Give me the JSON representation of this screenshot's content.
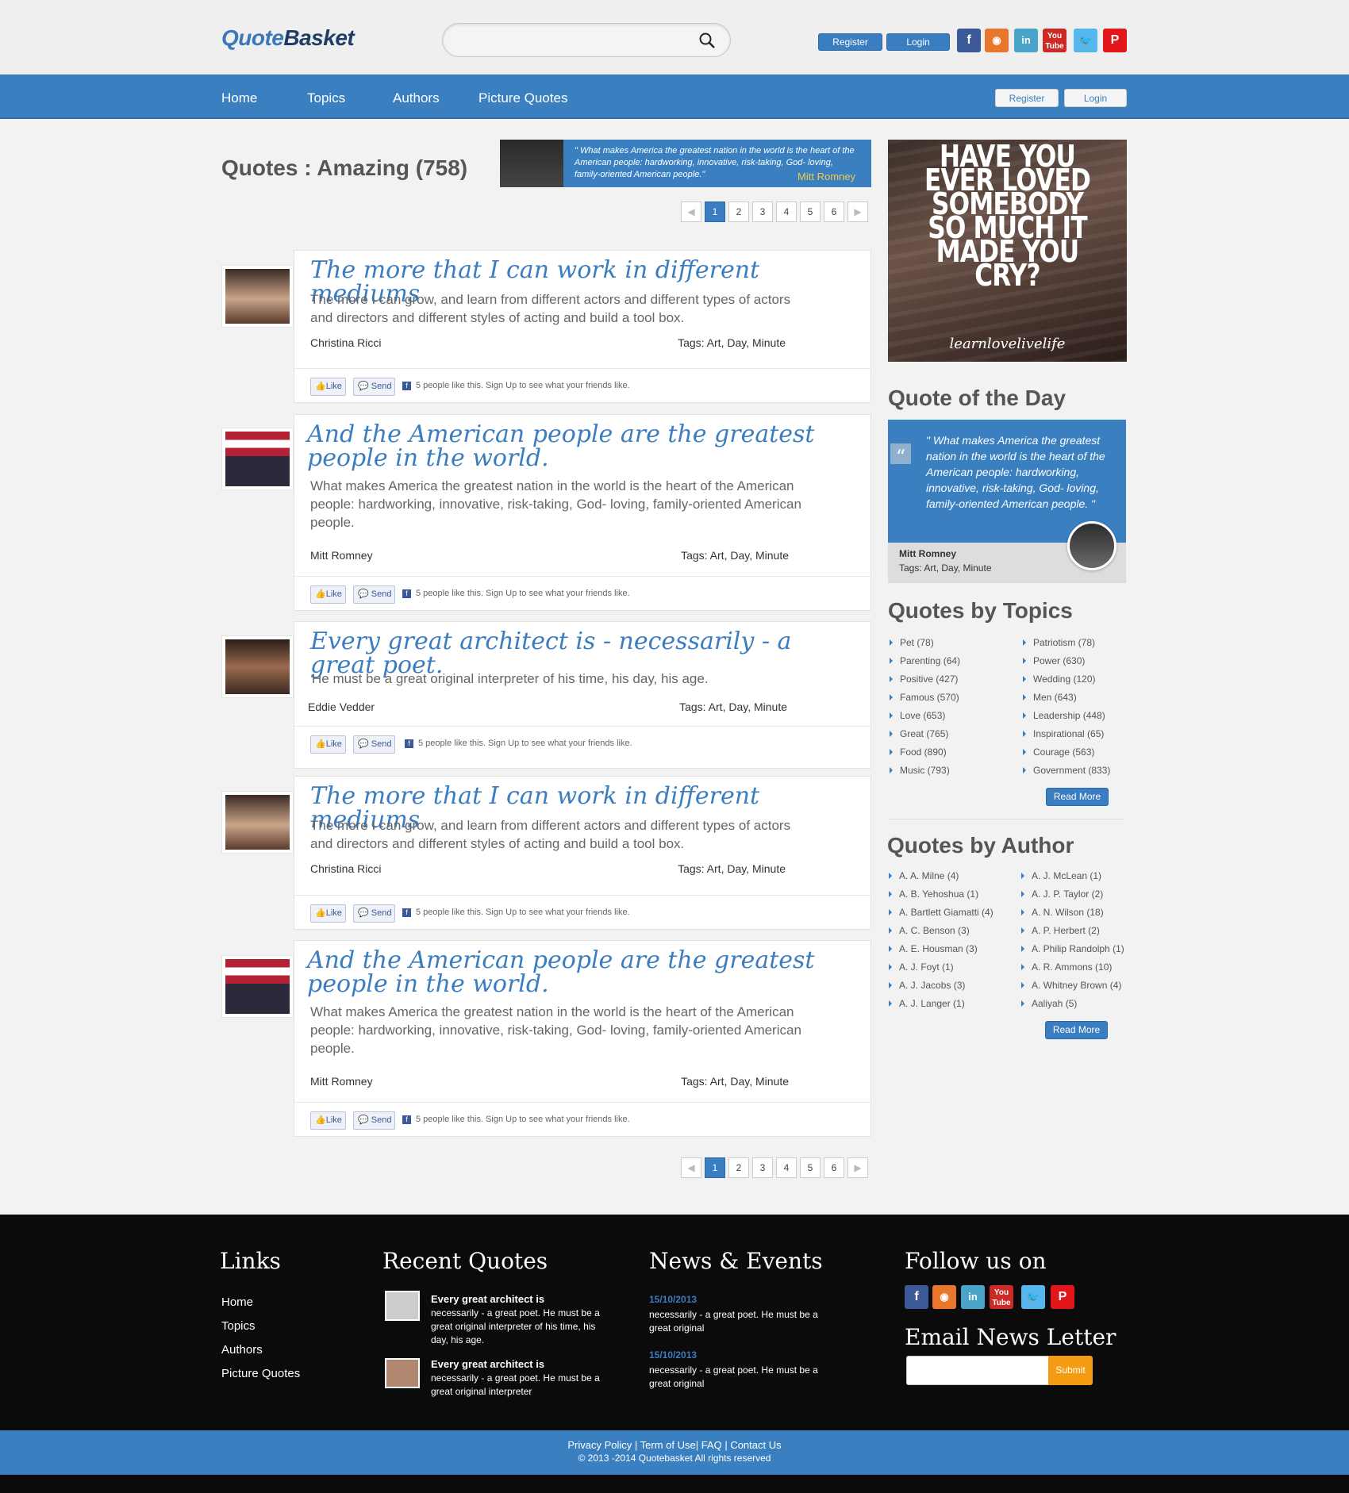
{
  "header": {
    "logo_part1": "Quote",
    "logo_part2": "Basket",
    "search_placeholder": "",
    "register": "Register",
    "login": "Login",
    "social": [
      "facebook-icon",
      "rss-icon",
      "linkedin-icon",
      "youtube-icon",
      "twitter-icon",
      "pinterest-icon"
    ]
  },
  "nav": {
    "items": [
      "Home",
      "Topics",
      "Authors",
      "Picture Quotes"
    ],
    "register": "Register",
    "login": "Login"
  },
  "main": {
    "title": "Quotes : Amazing (758)",
    "banner_quote": "\" What makes America the greatest nation in the world is the heart of the American people: hardworking, innovative, risk-taking, God- loving, family-oriented American people.\"",
    "banner_author": "Mitt Romney",
    "pages": [
      "1",
      "2",
      "3",
      "4",
      "5",
      "6"
    ],
    "quotes": [
      {
        "title": "The more that I can work in different mediums",
        "body": "The more I can grow, and learn from different actors and different types of actors and directors and different styles of acting and build a tool box.",
        "author": "Christina Ricci",
        "tags": "Tags: Art, Day, Minute",
        "like": "Like",
        "send": "Send",
        "fb_text": "5 people like this. Sign Up to see what your friends like."
      },
      {
        "title": "And the American people are the greatest people in the world.",
        "body": "What makes America the greatest nation in the world is the heart of the American people: hardworking, innovative, risk-taking, God- loving, family-oriented American people.",
        "author": "Mitt Romney",
        "tags": "Tags: Art, Day, Minute",
        "like": "Like",
        "send": "Send",
        "fb_text": "5 people like this. Sign Up to see what your friends like."
      },
      {
        "title": "Every great architect is - necessarily - a great poet.",
        "body": "He must be a great original interpreter of his time, his day, his age.",
        "author": "Eddie Vedder",
        "tags": "Tags: Art, Day, Minute",
        "like": "Like",
        "send": "Send",
        "fb_text": "5 people like this. Sign Up to see what your friends like."
      },
      {
        "title": "The more that I can work in different mediums",
        "body": "The more I can grow, and learn from different actors and different types of actors and directors and different styles of acting and build a tool box.",
        "author": "Christina Ricci",
        "tags": "Tags: Art, Day, Minute",
        "like": "Like",
        "send": "Send",
        "fb_text": "5 people like this. Sign Up to see what your friends like."
      },
      {
        "title": "And the American people are the greatest people in the world.",
        "body": "What makes America the greatest nation in the world is the heart of the American people: hardworking, innovative, risk-taking, God- loving, family-oriented American people.",
        "author": "Mitt Romney",
        "tags": "Tags: Art, Day, Minute",
        "like": "Like",
        "send": "Send",
        "fb_text": "5 people like this. Sign Up to see what your friends like."
      }
    ]
  },
  "sidebar": {
    "poster_text": "HAVE YOU EVER LOVED SOMEBODY SO MUCH IT MADE YOU CRY?",
    "poster_sig": "learnlovelivelife",
    "qotd_heading": "Quote of the Day",
    "qotd_quote": "\" What makes America the greatest nation in the world is the heart of the American people: hardworking, innovative, risk-taking, God- loving, family-oriented American people. \"",
    "qotd_author": "Mitt Romney",
    "qotd_tags": "Tags: Art, Day, Minute",
    "topics_heading": "Quotes by Topics",
    "topics_left": [
      "Pet (78)",
      "Parenting (64)",
      "Positive (427)",
      "Famous (570)",
      "Love (653)",
      "Great (765)",
      "Food (890)",
      "Music (793)"
    ],
    "topics_right": [
      "Patriotism (78)",
      "Power (630)",
      "Wedding (120)",
      "Men (643)",
      "Leadership (448)",
      "Inspirational (65)",
      "Courage (563)",
      "Government (833)"
    ],
    "read_more": "Read More",
    "authors_heading": "Quotes by Author",
    "authors_left": [
      "A. A. Milne (4)",
      "A. B. Yehoshua (1)",
      "A. Bartlett Giamatti (4)",
      "A. C. Benson (3)",
      "A. E. Housman (3)",
      "A. J. Foyt (1)",
      "A. J. Jacobs (3)",
      "A. J. Langer (1)"
    ],
    "authors_right": [
      "A. J. McLean (1)",
      "A. J. P. Taylor (2)",
      "A. N. Wilson (18)",
      "A. P. Herbert (2)",
      "A. Philip Randolph (1)",
      "A. R. Ammons (10)",
      "A. Whitney Brown (4)",
      "Aaliyah (5)"
    ]
  },
  "footer": {
    "links_heading": "Links",
    "links": [
      "Home",
      "Topics",
      "Authors",
      "Picture Quotes"
    ],
    "recent_heading": "Recent Quotes",
    "recent": [
      {
        "title": "Every great architect is",
        "text": "necessarily - a great poet. He must be a great original interpreter of his time, his day, his age."
      },
      {
        "title": "Every great architect is",
        "text": "necessarily - a great poet. He must be a great original interpreter"
      }
    ],
    "news_heading": "News & Events",
    "news": [
      {
        "date": "15/10/2013",
        "text": "necessarily - a great poet. He must be a great original"
      },
      {
        "date": "15/10/2013",
        "text": "necessarily - a great poet. He must be a great original"
      }
    ],
    "follow_heading": "Follow us on",
    "newsletter_heading": "Email News Letter",
    "submit": "Submit",
    "bottom_links": "Privacy Policy | Term of Use| FAQ | Contact Us",
    "copyright": "© 2013 -2014 Quotebasket All rights reserved"
  },
  "colors": {
    "brand": "#3a80c1",
    "accent": "#f39c12",
    "dark": "#0b0b0b"
  }
}
